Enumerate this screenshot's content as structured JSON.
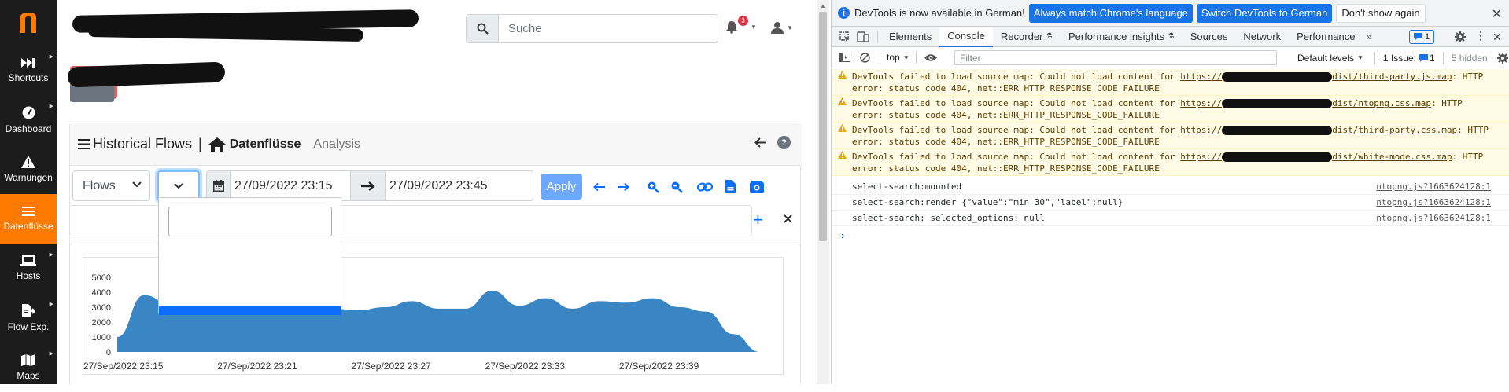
{
  "sidebar": {
    "items": [
      {
        "label": "Shortcuts",
        "icon": "fast-forward-icon"
      },
      {
        "label": "Dashboard",
        "icon": "gauge-icon"
      },
      {
        "label": "Warnungen",
        "icon": "warning-icon"
      },
      {
        "label": "Datenflüsse",
        "icon": "list-icon"
      },
      {
        "label": "Hosts",
        "icon": "laptop-icon"
      },
      {
        "label": "Flow Exp.",
        "icon": "file-export-icon"
      },
      {
        "label": "Maps",
        "icon": "map-icon"
      }
    ],
    "active_color": "#ff7a00",
    "bg_color": "#1c1c1c"
  },
  "topbar": {
    "search_placeholder": "Suche",
    "notification_count": "3"
  },
  "card": {
    "title": "Historical Flows",
    "separator": "|",
    "active_tab": "Datenflüsse",
    "tab_analysis": "Analysis",
    "help": "?"
  },
  "toolbar": {
    "view_select": "Flows",
    "date_from": "27/09/2022 23:15",
    "date_to": "27/09/2022 23:45",
    "apply_label": "Apply"
  },
  "chart_data": {
    "type": "area",
    "x": [
      "27/Sep/2022 23:15",
      "",
      "",
      "",
      "",
      "27/Sep/2022 23:21",
      "",
      "",
      "",
      "",
      "27/Sep/2022 23:27",
      "",
      "",
      "",
      "",
      "27/Sep/2022 23:33",
      "",
      "",
      "",
      "",
      "27/Sep/2022 23:39",
      "",
      "",
      "",
      ""
    ],
    "tick_labels": [
      "27/Sep/2022 23:15",
      "27/Sep/2022 23:21",
      "27/Sep/2022 23:27",
      "27/Sep/2022 23:33",
      "27/Sep/2022 23:39"
    ],
    "y_ticks": [
      "5000",
      "4000",
      "3000",
      "2000",
      "1000",
      "0"
    ],
    "values": [
      1000,
      3800,
      3200,
      3000,
      3100,
      3000,
      3400,
      3200,
      2900,
      2800,
      3000,
      3400,
      2900,
      2900,
      4100,
      3100,
      3600,
      2900,
      3400,
      3300,
      3600,
      3000,
      2700,
      1200,
      0
    ],
    "ylim": [
      0,
      5000
    ],
    "color": "#3a86c4"
  },
  "devtools": {
    "banner": {
      "text": "DevTools is now available in German!",
      "btn_match": "Always match Chrome's language",
      "btn_switch": "Switch DevTools to German",
      "btn_dismiss": "Don't show again"
    },
    "tabs": [
      "Elements",
      "Console",
      "Recorder",
      "Performance insights",
      "Sources",
      "Network",
      "Performance"
    ],
    "active_tab": "Console",
    "tab_badge": "1",
    "console_bar": {
      "context": "top",
      "filter_placeholder": "Filter",
      "levels": "Default levels",
      "issues": "1 Issue:",
      "issues_count": "1",
      "hidden": "5 hidden"
    },
    "messages": [
      {
        "level": "warning",
        "prefix": "DevTools failed to load source map: Could not load content for ",
        "url_start": "https://",
        "url_end": "dist/third-party.js.map",
        "suffix": ": HTTP",
        "line2": "error: status code 404, net::ERR_HTTP_RESPONSE_CODE_FAILURE"
      },
      {
        "level": "warning",
        "prefix": "DevTools failed to load source map: Could not load content for ",
        "url_start": "https://",
        "url_end": "dist/ntopng.css.map",
        "suffix": ": HTTP",
        "line2": "error: status code 404, net::ERR_HTTP_RESPONSE_CODE_FAILURE"
      },
      {
        "level": "warning",
        "prefix": "DevTools failed to load source map: Could not load content for ",
        "url_start": "https://",
        "url_end": "dist/third-party.css.map",
        "suffix": ": HTTP",
        "line2": "error: status code 404, net::ERR_HTTP_RESPONSE_CODE_FAILURE"
      },
      {
        "level": "warning",
        "prefix": "DevTools failed to load source map: Could not load content for ",
        "url_start": "https://",
        "url_end": "dist/white-mode.css.map",
        "suffix": ": HTTP",
        "line2": "error: status code 404, net::ERR_HTTP_RESPONSE_CODE_FAILURE"
      },
      {
        "level": "log",
        "text": "select-search:mounted",
        "source": "ntopng.js?1663624128:1"
      },
      {
        "level": "log",
        "text": "select-search:render {\"value\":\"min_30\",\"label\":null}",
        "source": "ntopng.js?1663624128:1"
      },
      {
        "level": "log",
        "text": "select-search: selected_options: null",
        "source": "ntopng.js?1663624128:1"
      }
    ]
  }
}
